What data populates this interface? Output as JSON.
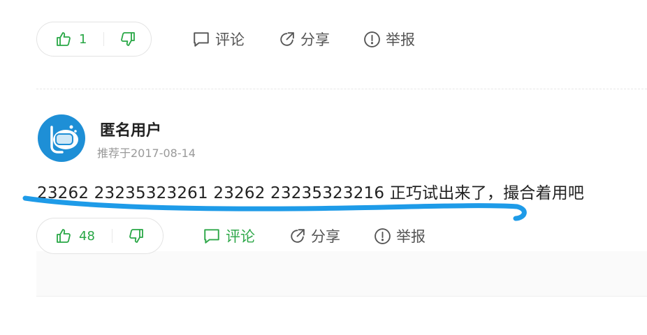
{
  "colors": {
    "accent_green": "#28a745",
    "text_gray": "#555555",
    "marker_blue": "#1e9be8"
  },
  "answer1": {
    "like_count": "1",
    "comment_label": "评论",
    "share_label": "分享",
    "report_label": "举报"
  },
  "answer2": {
    "username": "匿名用户",
    "recommend_meta": "推荐于2017-08-14",
    "text": "23262 23235323261 23262 23235323216 正巧试出来了，撮合着用吧",
    "like_count": "48",
    "comment_label": "评论",
    "share_label": "分享",
    "report_label": "举报"
  },
  "icons": {
    "like": "thumbs-up-icon",
    "dislike": "thumbs-down-icon",
    "comment": "speech-bubble-icon",
    "share": "share-arrow-icon",
    "report": "exclamation-circle-icon",
    "avatar": "diver-mask-avatar"
  }
}
